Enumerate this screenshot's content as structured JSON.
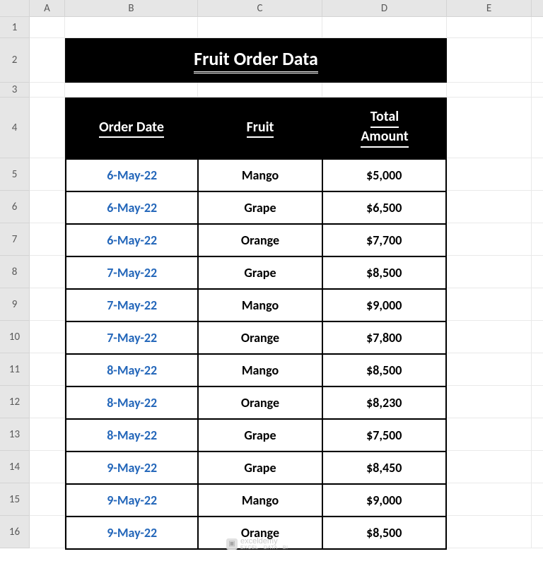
{
  "columns": [
    "A",
    "B",
    "C",
    "D",
    "E"
  ],
  "row_numbers": [
    "1",
    "2",
    "3",
    "4",
    "5",
    "6",
    "7",
    "8",
    "9",
    "10",
    "11",
    "12",
    "13",
    "14",
    "15",
    "16"
  ],
  "title": "Fruit Order Data",
  "headers": {
    "order_date": "Order Date",
    "fruit": "Fruit",
    "total_amount_line1": "Total",
    "total_amount_line2": "Amount"
  },
  "rows": [
    {
      "date": "6-May-22",
      "fruit": "Mango",
      "amount": "$5,000"
    },
    {
      "date": "6-May-22",
      "fruit": "Grape",
      "amount": "$6,500"
    },
    {
      "date": "6-May-22",
      "fruit": "Orange",
      "amount": "$7,700"
    },
    {
      "date": "7-May-22",
      "fruit": "Grape",
      "amount": "$8,500"
    },
    {
      "date": "7-May-22",
      "fruit": "Mango",
      "amount": "$9,000"
    },
    {
      "date": "7-May-22",
      "fruit": "Orange",
      "amount": "$7,800"
    },
    {
      "date": "8-May-22",
      "fruit": "Mango",
      "amount": "$8,500"
    },
    {
      "date": "8-May-22",
      "fruit": "Orange",
      "amount": "$8,230"
    },
    {
      "date": "8-May-22",
      "fruit": "Grape",
      "amount": "$7,500"
    },
    {
      "date": "9-May-22",
      "fruit": "Grape",
      "amount": "$8,450"
    },
    {
      "date": "9-May-22",
      "fruit": "Mango",
      "amount": "$9,000"
    },
    {
      "date": "9-May-22",
      "fruit": "Orange",
      "amount": "$8,500"
    }
  ],
  "watermark": {
    "brand": "exceldemy",
    "sub": "EXCEL · DATA · BI"
  },
  "row_heights": {
    "1": 30,
    "2": 63,
    "3": 21,
    "4": 86,
    "data": 46
  },
  "col_widths": {
    "A": 50,
    "B": 188,
    "C": 176,
    "D": 176,
    "E": 120
  }
}
